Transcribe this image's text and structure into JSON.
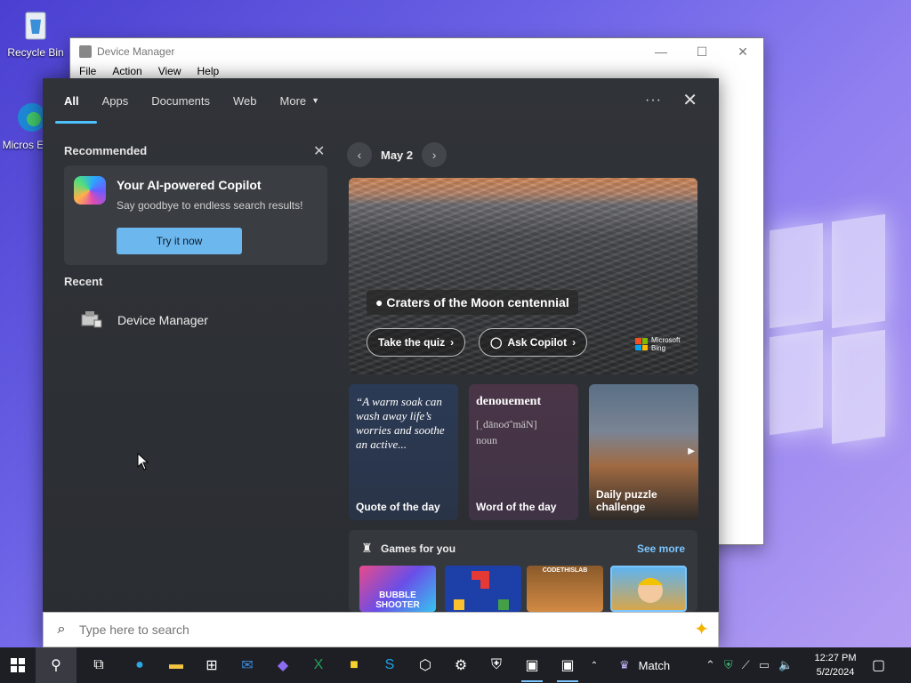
{
  "desktop": {
    "icons": [
      {
        "name": "recycle-bin-icon",
        "label": "Recycle Bin"
      },
      {
        "name": "edge-shortcut-icon",
        "label": "Micros Edge"
      }
    ]
  },
  "device_manager": {
    "title": "Device Manager",
    "menu": [
      "File",
      "Action",
      "View",
      "Help"
    ]
  },
  "search_flyout": {
    "tabs": [
      {
        "label": "All",
        "active": true
      },
      {
        "label": "Apps"
      },
      {
        "label": "Documents"
      },
      {
        "label": "Web"
      },
      {
        "label": "More"
      }
    ],
    "recommended": {
      "heading": "Recommended",
      "card_title": "Your AI-powered Copilot",
      "card_subtitle": "Say goodbye to endless search results!",
      "button": "Try it now"
    },
    "recent": {
      "heading": "Recent",
      "items": [
        "Device Manager"
      ]
    },
    "date": "May 2",
    "hero": {
      "caption": "Craters of the Moon centennial",
      "quiz_button": "Take the quiz",
      "copilot_button": "Ask Copilot",
      "brand": "Microsoft Bing"
    },
    "tiles": {
      "quote_text": "“A warm soak can wash away life’s worries and soothe an active...",
      "quote_title": "Quote of the day",
      "word": "denouement",
      "word_pron": "[ˌdānoo͞ˈmäN]",
      "word_pos": "noun",
      "word_title": "Word of the day",
      "puzzle_title": "Daily puzzle challenge"
    },
    "games": {
      "heading": "Games for you",
      "see_more": "See more",
      "items": [
        "BUBBLE SHOOTER",
        "Blocks",
        "CODETHISLAB",
        "Miner"
      ]
    },
    "search_placeholder": "Type here to search"
  },
  "taskbar": {
    "match_label": "Match",
    "time": "12:27 PM",
    "date": "5/2/2024"
  },
  "colors": {
    "accent": "#4cc2ff",
    "flyout_bg": "#2c2f33",
    "taskbar_bg": "#1e1f24"
  }
}
